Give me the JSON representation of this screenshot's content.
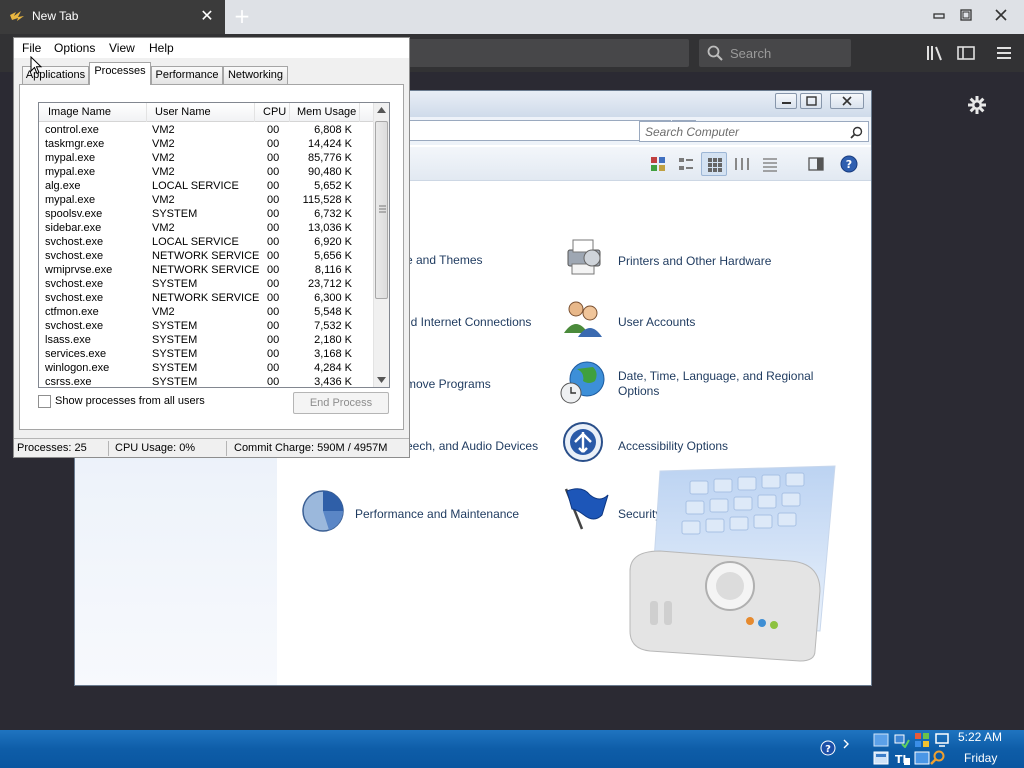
{
  "browser": {
    "tab_title": "New Tab",
    "search_placeholder": "Search"
  },
  "control_panel": {
    "search_placeholder": "Search Computer",
    "categories": [
      {
        "label": "e and Themes"
      },
      {
        "label": "Printers and Other Hardware"
      },
      {
        "label": "nd Internet Connections"
      },
      {
        "label": "User Accounts"
      },
      {
        "label": "move Programs"
      },
      {
        "label": "Date, Time, Language, and Regional Options"
      },
      {
        "label": "eech, and Audio Devices"
      },
      {
        "label": "Accessibility Options"
      },
      {
        "label": "Performance and Maintenance"
      },
      {
        "label": "Security Center"
      }
    ]
  },
  "task_manager": {
    "menu": [
      "File",
      "Options",
      "View",
      "Help"
    ],
    "tabs": [
      "Applications",
      "Processes",
      "Performance",
      "Networking"
    ],
    "active_tab": "Processes",
    "columns": [
      "Image Name",
      "User Name",
      "CPU",
      "Mem Usage"
    ],
    "rows": [
      {
        "name": "control.exe",
        "user": "VM2",
        "cpu": "00",
        "mem": "6,808 K"
      },
      {
        "name": "taskmgr.exe",
        "user": "VM2",
        "cpu": "00",
        "mem": "14,424 K"
      },
      {
        "name": "mypal.exe",
        "user": "VM2",
        "cpu": "00",
        "mem": "85,776 K"
      },
      {
        "name": "mypal.exe",
        "user": "VM2",
        "cpu": "00",
        "mem": "90,480 K"
      },
      {
        "name": "alg.exe",
        "user": "LOCAL SERVICE",
        "cpu": "00",
        "mem": "5,652 K"
      },
      {
        "name": "mypal.exe",
        "user": "VM2",
        "cpu": "00",
        "mem": "115,528 K"
      },
      {
        "name": "spoolsv.exe",
        "user": "SYSTEM",
        "cpu": "00",
        "mem": "6,732 K"
      },
      {
        "name": "sidebar.exe",
        "user": "VM2",
        "cpu": "00",
        "mem": "13,036 K"
      },
      {
        "name": "svchost.exe",
        "user": "LOCAL SERVICE",
        "cpu": "00",
        "mem": "6,920 K"
      },
      {
        "name": "svchost.exe",
        "user": "NETWORK SERVICE",
        "cpu": "00",
        "mem": "5,656 K"
      },
      {
        "name": "wmiprvse.exe",
        "user": "NETWORK SERVICE",
        "cpu": "00",
        "mem": "8,116 K"
      },
      {
        "name": "svchost.exe",
        "user": "SYSTEM",
        "cpu": "00",
        "mem": "23,712 K"
      },
      {
        "name": "svchost.exe",
        "user": "NETWORK SERVICE",
        "cpu": "00",
        "mem": "6,300 K"
      },
      {
        "name": "ctfmon.exe",
        "user": "VM2",
        "cpu": "00",
        "mem": "5,548 K"
      },
      {
        "name": "svchost.exe",
        "user": "SYSTEM",
        "cpu": "00",
        "mem": "7,532 K"
      },
      {
        "name": "lsass.exe",
        "user": "SYSTEM",
        "cpu": "00",
        "mem": "2,180 K"
      },
      {
        "name": "services.exe",
        "user": "SYSTEM",
        "cpu": "00",
        "mem": "3,168 K"
      },
      {
        "name": "winlogon.exe",
        "user": "SYSTEM",
        "cpu": "00",
        "mem": "4,284 K"
      },
      {
        "name": "csrss.exe",
        "user": "SYSTEM",
        "cpu": "00",
        "mem": "3,436 K"
      }
    ],
    "show_all_label": "Show processes from all users",
    "end_process_label": "End Process",
    "status": {
      "processes": "Processes: 25",
      "cpu": "CPU Usage: 0%",
      "commit": "Commit Charge: 590M / 4957M"
    }
  },
  "taskbar": {
    "time": "5:22 AM",
    "day": "Friday"
  },
  "colors": {
    "browser_dark": "#2b2a33",
    "taskbar_blue": "#0e5da8",
    "link_text": "#1e3a5f"
  }
}
